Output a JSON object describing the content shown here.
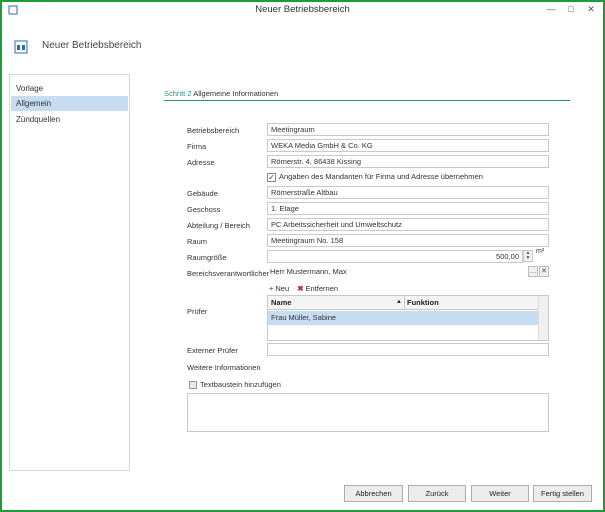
{
  "window": {
    "title": "Neuer Betriebsbereich",
    "minimize": "—",
    "maximize": "□",
    "close": "✕"
  },
  "header": {
    "title": "Neuer Betriebsbereich"
  },
  "sidebar": {
    "items": [
      {
        "label": "Vorlage"
      },
      {
        "label": "Allgemein",
        "active": true
      },
      {
        "label": "Zündquellen"
      }
    ]
  },
  "step": {
    "number": "Schritt 2",
    "title": "Allgemeine Informationen"
  },
  "form": {
    "betriebsbereich": {
      "label": "Betriebsbereich",
      "value": "Meetingraum"
    },
    "firma": {
      "label": "Firma",
      "value": "WEKA Media GmbH & Co. KG"
    },
    "adresse": {
      "label": "Adresse",
      "value": "Römerstr. 4, 86438 Kissing"
    },
    "checkbox": {
      "label": "Angaben des Mandanten für Firma und Adresse übernehmen",
      "checked": true,
      "mark": "✓"
    },
    "gebaeude": {
      "label": "Gebäude",
      "value": "Römerstraße Altbau"
    },
    "geschoss": {
      "label": "Geschoss",
      "value": "1. Etage"
    },
    "abteilung": {
      "label": "Abteilung / Bereich",
      "value": "PC Arbeitssicherheit und Umweltschutz"
    },
    "raum": {
      "label": "Raum",
      "value": "Meetingraum No. 158"
    },
    "raumgroesse": {
      "label": "Raumgröße",
      "value": "500,00",
      "unit": "m²",
      "up": "▲",
      "down": "▼"
    },
    "verantwortlicher": {
      "label": "Bereichsverantwortlicher",
      "value": "Herr Mustermann, Max",
      "more": "…",
      "clear": "✕"
    },
    "pruefer": {
      "label": "Prüfer",
      "add": "Neu",
      "add_icon": "+",
      "remove": "Entfernen",
      "remove_icon": "✖",
      "columns": [
        "Name",
        "Funktion"
      ],
      "sort_icon": "▲",
      "rows": [
        {
          "name": "Frau Müller, Sabine",
          "funktion": ""
        }
      ]
    },
    "externer_pruefer": {
      "label": "Externer Prüfer",
      "value": ""
    },
    "weitere": {
      "title": "Weitere Informationen",
      "textbaustein": "Textbaustein hinzufügen"
    }
  },
  "footer": {
    "abbrechen": "Abbrechen",
    "zurueck": "Zurück",
    "weiter": "Weiter",
    "fertig": "Fertig stellen"
  },
  "colors": {
    "accent": "#2a8f83",
    "selection": "#c6dcf0",
    "frame": "#1f9a3a"
  }
}
